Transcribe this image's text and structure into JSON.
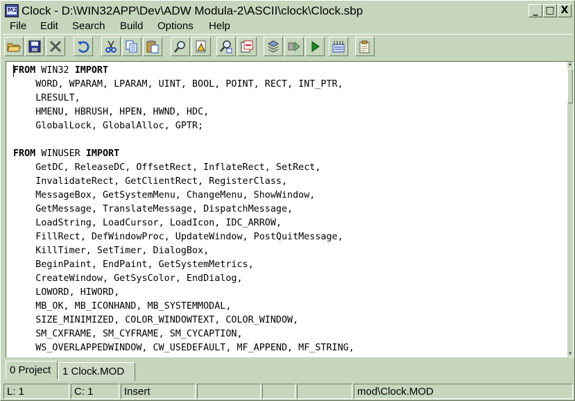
{
  "window": {
    "title": "Clock - D:\\WIN32APP\\Dev\\ADW Modula-2\\ASCII\\clock\\Clock.sbp",
    "app_icon": "modula2-app-icon",
    "controls": {
      "minimize": "_",
      "maximize": "□",
      "close": "X"
    }
  },
  "menu": [
    "File",
    "Edit",
    "Search",
    "Build",
    "Options",
    "Help"
  ],
  "toolbar": [
    {
      "name": "open-folder-icon"
    },
    {
      "name": "save-disk-icon"
    },
    {
      "name": "close-file-icon"
    },
    {
      "name": "undo-icon"
    },
    {
      "name": "cut-scissors-icon"
    },
    {
      "name": "copy-icon"
    },
    {
      "name": "paste-icon"
    },
    {
      "name": "find-icon"
    },
    {
      "name": "find-in-files-icon"
    },
    {
      "name": "replace-icon"
    },
    {
      "name": "goto-icon"
    },
    {
      "name": "compile-icon"
    },
    {
      "name": "step-icon"
    },
    {
      "name": "run-icon"
    },
    {
      "name": "build-icon"
    },
    {
      "name": "project-icon"
    }
  ],
  "editor": {
    "lines": [
      [
        {
          "t": "FROM",
          "k": true
        },
        {
          "t": " WIN32 "
        },
        {
          "t": "IMPORT",
          "k": true
        }
      ],
      [
        {
          "t": "    WORD, WPARAM, LPARAM, UINT, BOOL, POINT, RECT, INT_PTR,"
        }
      ],
      [
        {
          "t": "    LRESULT,"
        }
      ],
      [
        {
          "t": "    HMENU, HBRUSH, HPEN, HWND, HDC,"
        }
      ],
      [
        {
          "t": "    GlobalLock, GlobalAlloc, GPTR;"
        }
      ],
      [
        {
          "t": ""
        }
      ],
      [
        {
          "t": "FROM",
          "k": true
        },
        {
          "t": " WINUSER "
        },
        {
          "t": "IMPORT",
          "k": true
        }
      ],
      [
        {
          "t": "    GetDC, ReleaseDC, OffsetRect, InflateRect, SetRect,"
        }
      ],
      [
        {
          "t": "    InvalidateRect, GetClientRect, RegisterClass,"
        }
      ],
      [
        {
          "t": "    MessageBox, GetSystemMenu, ChangeMenu, ShowWindow,"
        }
      ],
      [
        {
          "t": "    GetMessage, TranslateMessage, DispatchMessage,"
        }
      ],
      [
        {
          "t": "    LoadString, LoadCursor, LoadIcon, IDC_ARROW,"
        }
      ],
      [
        {
          "t": "    FillRect, DefWindowProc, UpdateWindow, PostQuitMessage,"
        }
      ],
      [
        {
          "t": "    KillTimer, SetTimer, DialogBox,"
        }
      ],
      [
        {
          "t": "    BeginPaint, EndPaint, GetSystemMetrics,"
        }
      ],
      [
        {
          "t": "    CreateWindow, GetSysColor, EndDialog,"
        }
      ],
      [
        {
          "t": "    LOWORD, HIWORD,"
        }
      ],
      [
        {
          "t": "    MB_OK, MB_ICONHAND, MB_SYSTEMMODAL,"
        }
      ],
      [
        {
          "t": "    SIZE_MINIMIZED, COLOR_WINDOWTEXT, COLOR_WINDOW,"
        }
      ],
      [
        {
          "t": "    SM_CXFRAME, SM_CYFRAME, SM_CYCAPTION,"
        }
      ],
      [
        {
          "t": "    WS_OVERLAPPEDWINDOW, CW_USEDEFAULT, MF_APPEND, MF_STRING,"
        }
      ]
    ]
  },
  "tabs": [
    {
      "label": "0 Project",
      "active": false
    },
    {
      "label": "1 Clock.MOD",
      "active": true
    }
  ],
  "status": {
    "line": "L: 1",
    "column": "C: 1",
    "mode": "Insert",
    "cell4": "",
    "cell5": "",
    "cell6": "",
    "file": "mod\\Clock.MOD"
  },
  "colors": {
    "chrome": "#c6d6bd",
    "editor_bg": "#ffffff"
  }
}
